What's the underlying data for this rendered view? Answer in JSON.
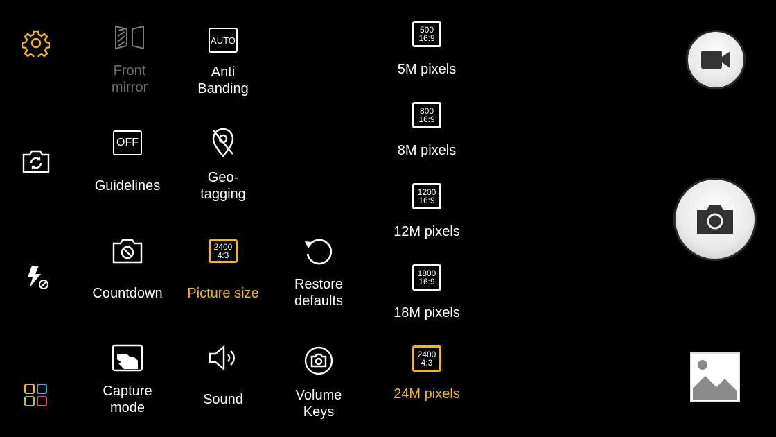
{
  "sidebar": {
    "items": [
      {
        "name": "settings-icon",
        "color": "#f5b80f"
      },
      {
        "name": "switch-camera-icon"
      },
      {
        "name": "flash-off-icon"
      },
      {
        "name": "modes-grid-icon"
      }
    ]
  },
  "settings": {
    "front_mirror": {
      "label": "Front\nmirror"
    },
    "anti_banding": {
      "label": "Anti\nBanding",
      "badge": "AUTO"
    },
    "guidelines": {
      "label": "Guidelines",
      "badge": "OFF"
    },
    "geo_tagging": {
      "label": "Geo-\ntagging"
    },
    "countdown": {
      "label": "Countdown"
    },
    "picture_size": {
      "label": "Picture size",
      "badge_top": "2400",
      "badge_bottom": "4:3"
    },
    "restore_defaults": {
      "label": "Restore\ndefaults"
    },
    "capture_mode": {
      "label": "Capture\nmode"
    },
    "sound": {
      "label": "Sound"
    },
    "volume_keys": {
      "label": "Volume\nKeys"
    }
  },
  "picture_size_options": [
    {
      "top": "500",
      "bottom": "16:9",
      "label": "5M pixels",
      "selected": false
    },
    {
      "top": "800",
      "bottom": "16:9",
      "label": "8M pixels",
      "selected": false
    },
    {
      "top": "1200",
      "bottom": "16:9",
      "label": "12M pixels",
      "selected": false
    },
    {
      "top": "1800",
      "bottom": "16:9",
      "label": "18M pixels",
      "selected": false
    },
    {
      "top": "2400",
      "bottom": "4:3",
      "label": "24M pixels",
      "selected": true
    }
  ],
  "controls": {
    "video_button": "video-camera-icon",
    "shutter_button": "camera-icon",
    "gallery": "gallery-thumbnail-icon"
  },
  "colors": {
    "accent": "#f5b80f",
    "disabled": "#6e6e6e"
  }
}
